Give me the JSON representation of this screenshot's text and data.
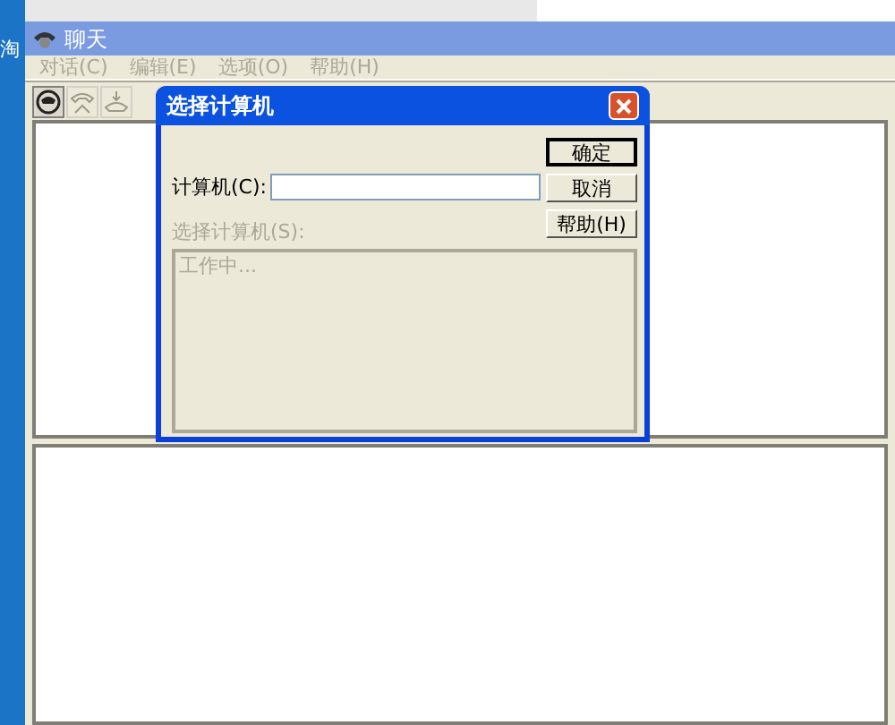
{
  "desktop": {
    "label": "淘"
  },
  "window": {
    "title": "聊天"
  },
  "menu": [
    {
      "label": "对话(C)",
      "disabled": true
    },
    {
      "label": "编辑(E)",
      "disabled": true
    },
    {
      "label": "选项(O)",
      "disabled": true
    },
    {
      "label": "帮助(H)",
      "disabled": true
    }
  ],
  "toolbar": [
    {
      "kind": "dial",
      "disabled": false
    },
    {
      "kind": "hangup",
      "disabled": true
    },
    {
      "kind": "answer",
      "disabled": true
    }
  ],
  "dialog": {
    "title": "选择计算机",
    "computer_label": "计算机(C):",
    "list_label": "选择计算机(S):",
    "list_disabled": true,
    "list_items": [
      "工作中..."
    ],
    "buttons": [
      {
        "label": "确定",
        "default": true
      },
      {
        "label": "取消",
        "default": false
      },
      {
        "label": "帮助(H)",
        "default": false
      }
    ]
  }
}
